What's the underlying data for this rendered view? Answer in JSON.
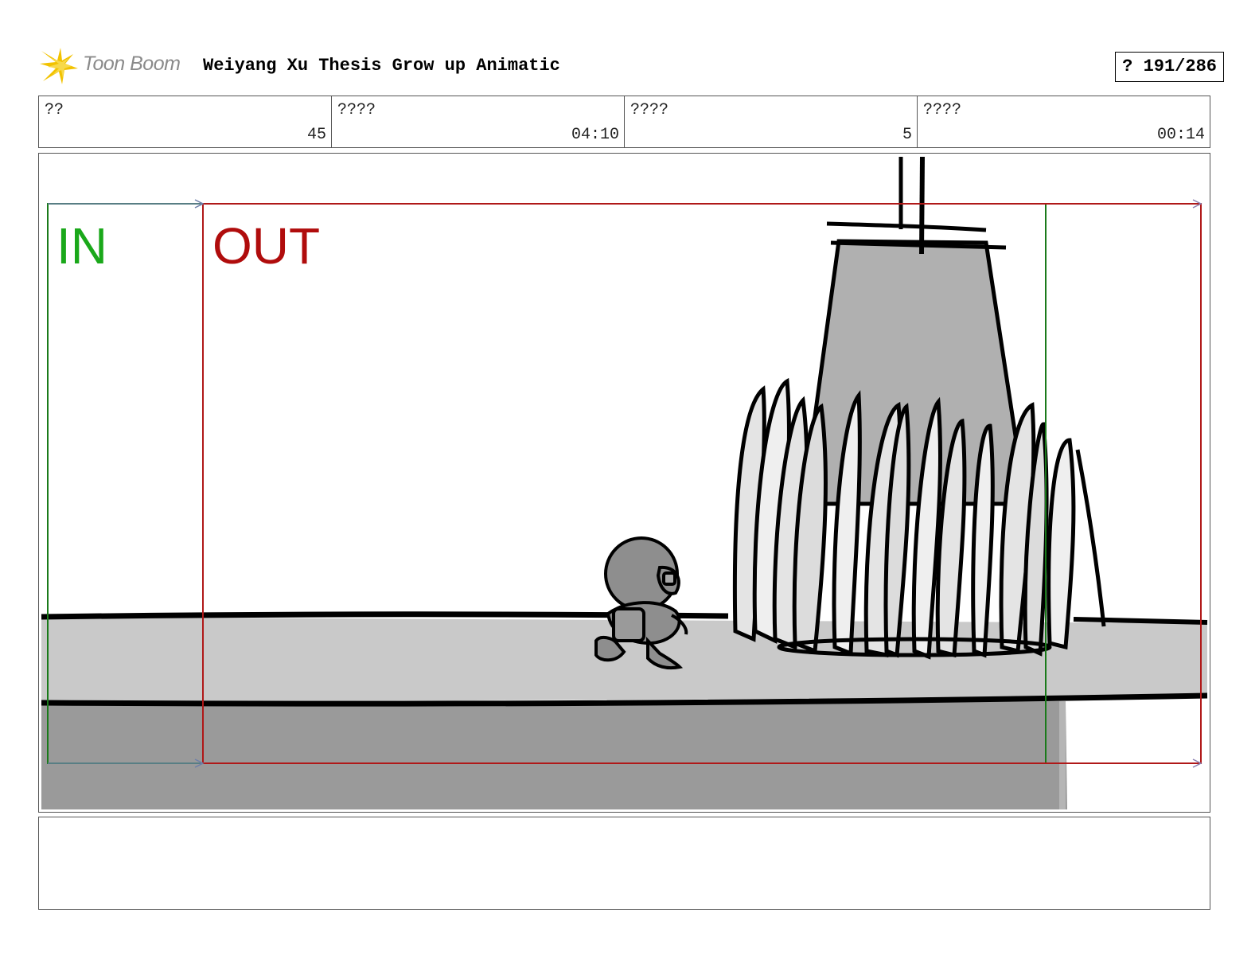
{
  "header": {
    "logo_text": "Toon Boom",
    "title": "Weiyang Xu Thesis Grow up Animatic",
    "page_indicator": "? 191/286"
  },
  "info": [
    {
      "label": "??",
      "value": "45"
    },
    {
      "label": "????",
      "value": "04:10"
    },
    {
      "label": "????",
      "value": "5"
    },
    {
      "label": "????",
      "value": "00:14"
    }
  ],
  "panel": {
    "in_label": "IN",
    "out_label": "OUT"
  },
  "colors": {
    "in_frame": "#1a7a1a",
    "in_text": "#1aa81a",
    "out_frame": "#b01818",
    "out_text": "#b00c0c",
    "logo_burst": "#f2c200",
    "ground_light": "#c9c9c9",
    "ground_dark": "#9a9a9a",
    "tower": "#b0b0b0",
    "character": "#8e8e8e"
  },
  "icons": {
    "logo": "toon-boom-starburst-icon"
  },
  "notes": {
    "text": ""
  }
}
